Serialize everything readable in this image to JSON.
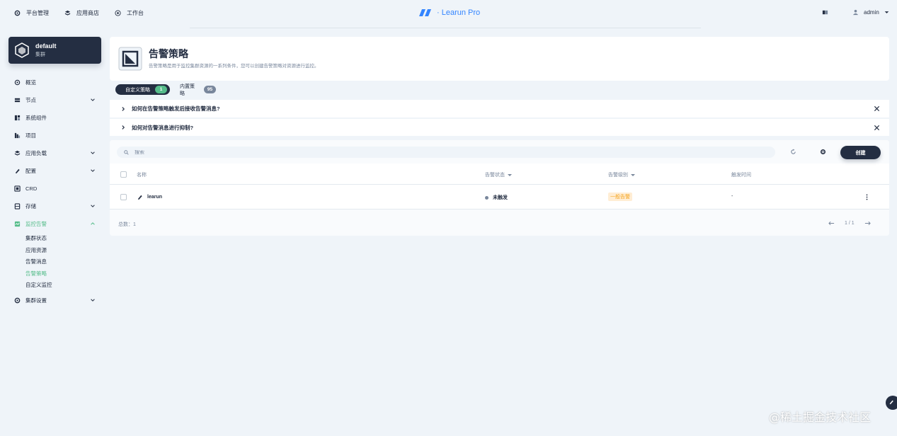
{
  "topnav": [
    {
      "label": "平台管理",
      "icon": "settings-icon"
    },
    {
      "label": "应用商店",
      "icon": "appstore-icon"
    },
    {
      "label": "工作台",
      "icon": "dashboard-icon"
    }
  ],
  "logo": {
    "text": "· Learun Pro"
  },
  "user": {
    "name": "admin"
  },
  "cluster": {
    "name": "default",
    "sub": "集群"
  },
  "sidebar": {
    "items": [
      {
        "label": "概览",
        "icon": "overview-icon"
      },
      {
        "label": "节点",
        "icon": "node-icon",
        "expandable": true
      },
      {
        "label": "系统组件",
        "icon": "components-icon"
      },
      {
        "label": "项目",
        "icon": "project-icon"
      },
      {
        "label": "应用负载",
        "icon": "workload-icon",
        "expandable": true
      },
      {
        "label": "配置",
        "icon": "config-icon",
        "expandable": true
      },
      {
        "label": "CRD",
        "icon": "crd-icon"
      },
      {
        "label": "存储",
        "icon": "storage-icon",
        "expandable": true
      },
      {
        "label": "监控告警",
        "icon": "monitor-icon",
        "expanded": true
      }
    ],
    "monitor_children": [
      "集群状态",
      "应用资源",
      "告警消息",
      "告警策略",
      "自定义监控"
    ],
    "active_child": "告警策略",
    "last": {
      "label": "集群设置",
      "icon": "cluster-settings-icon"
    }
  },
  "header": {
    "title": "告警策略",
    "desc": "告警策略是用于监控集群资源的一系列条件，您可以创建告警策略对资源进行监控。"
  },
  "tabs": [
    {
      "label": "自定义策略",
      "count": "1"
    },
    {
      "label": "内置策略",
      "count": "95"
    }
  ],
  "faq": [
    "如何在告警策略触发后接收告警消息?",
    "如何对告警消息进行抑制?"
  ],
  "search": {
    "placeholder": "搜索"
  },
  "create_label": "创建",
  "table": {
    "columns": [
      "名称",
      "告警状态",
      "告警级别",
      "触发时间"
    ],
    "rows": [
      {
        "name": "learun",
        "status": "未触发",
        "level": "一般告警",
        "time": "-"
      }
    ]
  },
  "footer": {
    "total": "总数：1",
    "page": "1 / 1"
  },
  "watermark": "@稀土掘金技术社区",
  "colors": {
    "dark": "#242e42",
    "green": "#55bc8a",
    "blue": "#3385ff",
    "warning_bg": "#ffedd4",
    "warning_text": "#f5a623"
  }
}
